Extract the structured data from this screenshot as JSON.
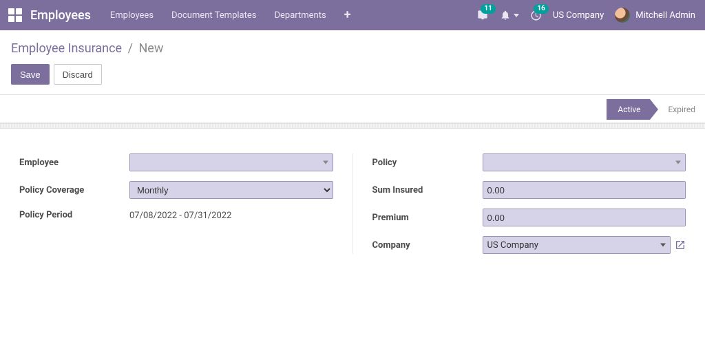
{
  "navbar": {
    "brand": "Employees",
    "links": [
      "Employees",
      "Document Templates",
      "Departments"
    ],
    "messages_badge": "11",
    "activities_badge": "16",
    "company": "US Company",
    "user": "Mitchell Admin"
  },
  "breadcrumb": {
    "root": "Employee Insurance",
    "current": "New"
  },
  "buttons": {
    "save": "Save",
    "discard": "Discard"
  },
  "status": {
    "active": "Active",
    "expired": "Expired"
  },
  "form": {
    "left": {
      "employee_label": "Employee",
      "employee_value": "",
      "coverage_label": "Policy Coverage",
      "coverage_value": "Monthly",
      "period_label": "Policy Period",
      "period_value": "07/08/2022 - 07/31/2022"
    },
    "right": {
      "policy_label": "Policy",
      "policy_value": "",
      "sum_label": "Sum Insured",
      "sum_value": "0.00",
      "premium_label": "Premium",
      "premium_value": "0.00",
      "company_label": "Company",
      "company_value": "US Company"
    }
  }
}
